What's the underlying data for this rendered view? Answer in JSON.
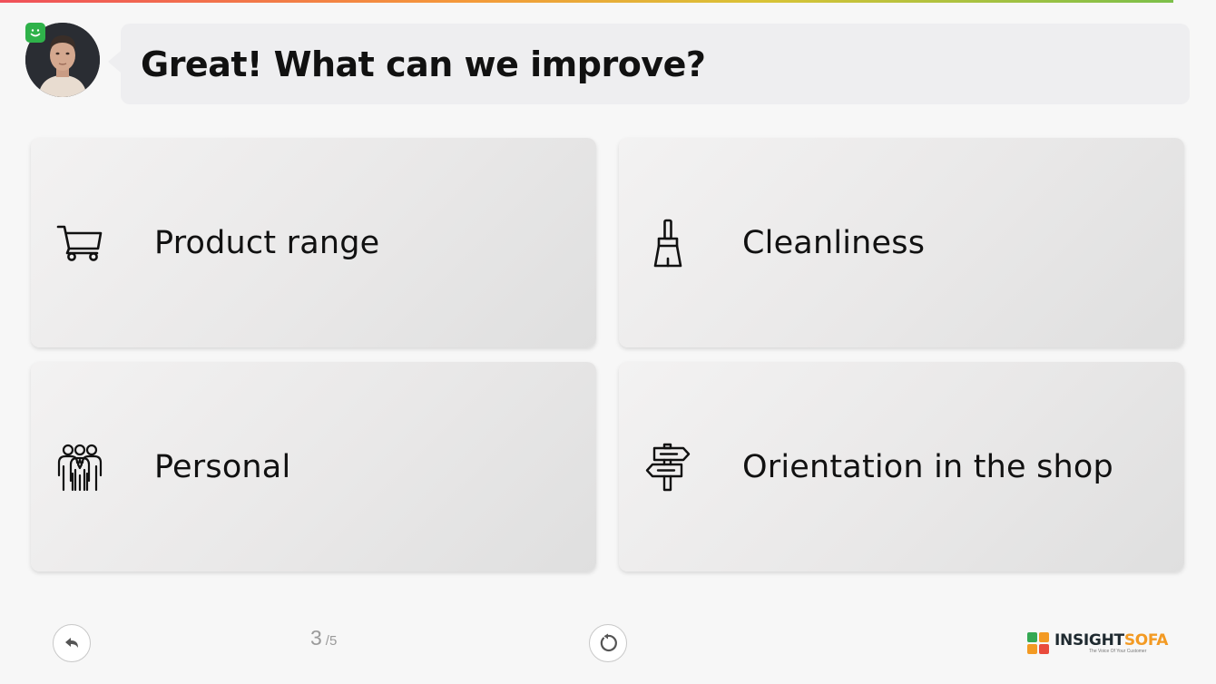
{
  "progress": {
    "value": 0.965
  },
  "header": {
    "question": "Great! What can we improve?",
    "avatar_icon": "person-photo"
  },
  "options": [
    {
      "label": "Product range",
      "icon": "shopping-cart-icon"
    },
    {
      "label": "Cleanliness",
      "icon": "broom-icon"
    },
    {
      "label": "Personal",
      "icon": "staff-group-icon"
    },
    {
      "label": "Orientation in the shop",
      "icon": "signpost-icon"
    }
  ],
  "footer": {
    "back_icon": "back-arrow-icon",
    "page_current": "3",
    "page_total": "/5",
    "restart_icon": "restart-icon",
    "logo_brand_a": "INSIGHT",
    "logo_brand_b": "SOFA",
    "logo_tagline": "The Voice Of Your Customer"
  },
  "colors": {
    "badge_green": "#2fb24a",
    "logo_red": "#e94b3c",
    "logo_orange": "#f39a23",
    "logo_green": "#34a853",
    "logo_dark": "#1f2a30"
  }
}
